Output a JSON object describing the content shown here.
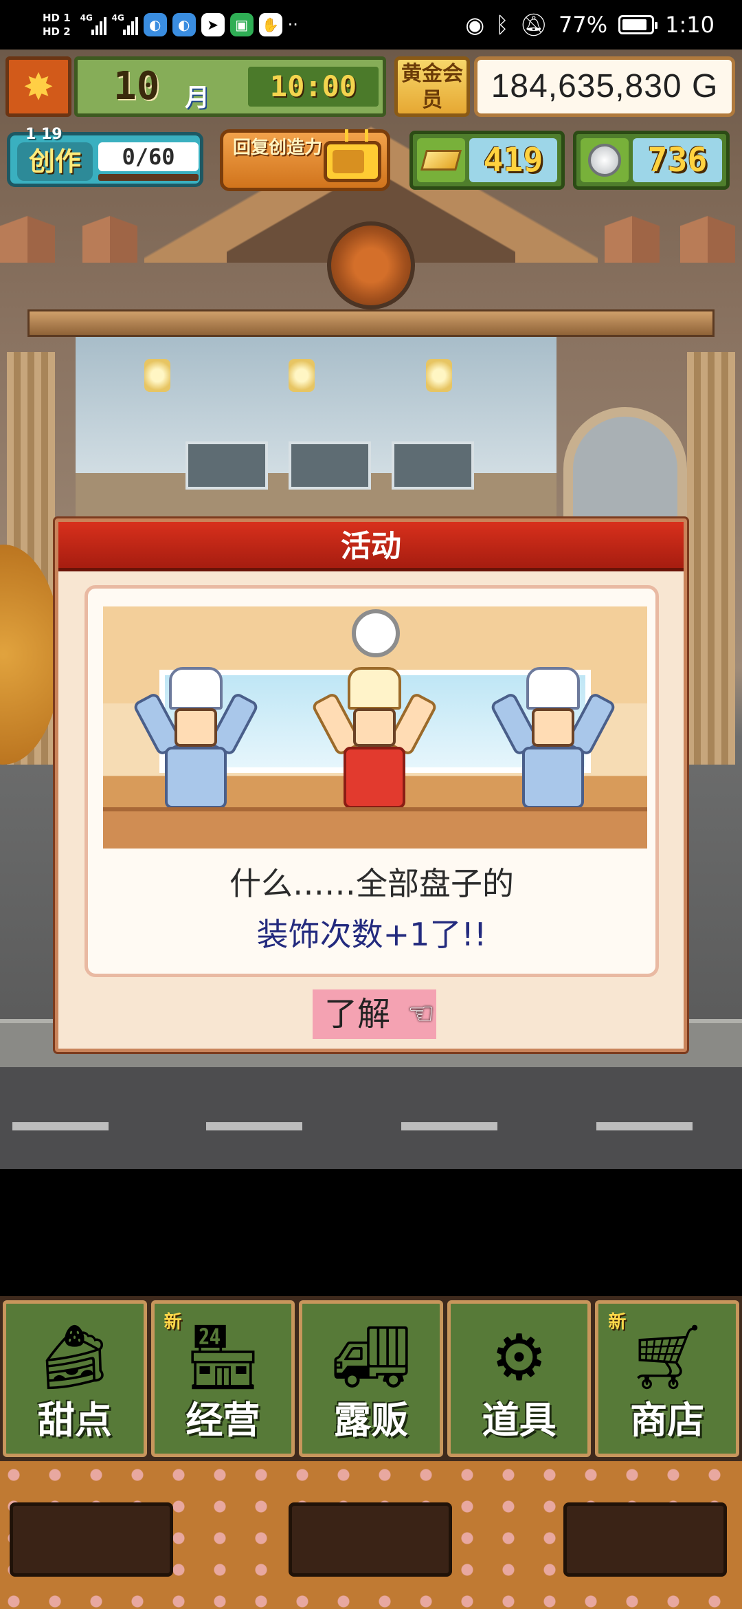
{
  "statusbar": {
    "sim1": "HD 1",
    "sim2": "HD 2",
    "net1": "4G",
    "net2": "4G",
    "battery": "77%",
    "time": "1:10"
  },
  "hud": {
    "month_number": "10",
    "month_label": "月",
    "clock": "10:00",
    "gold_member": "黄金会员",
    "money": "184,635,830 G",
    "create_level": "1 19",
    "create_label": "创作",
    "create_value": "0/60",
    "restore_label": "回复创造力",
    "gold_bars": "419",
    "coins": "736"
  },
  "dialog": {
    "title": "活动",
    "line1": "什么……全部盘子的",
    "line2": "装饰次数+1了!!",
    "ok_label": "了解"
  },
  "menu": {
    "items": [
      {
        "label": "甜点",
        "icon": "cake-icon",
        "is_new": false
      },
      {
        "label": "经营",
        "icon": "shop-building-icon",
        "is_new": true,
        "new_tag": "新"
      },
      {
        "label": "露贩",
        "icon": "food-truck-icon",
        "is_new": false
      },
      {
        "label": "道具",
        "icon": "gear-bag-icon",
        "is_new": false
      },
      {
        "label": "商店",
        "icon": "shopping-cart-icon",
        "is_new": true,
        "new_tag": "新"
      }
    ]
  },
  "colors": {
    "dialog_header": "#b8231a",
    "menu_bg": "#577a38",
    "accent_gold": "#f2c24c"
  }
}
